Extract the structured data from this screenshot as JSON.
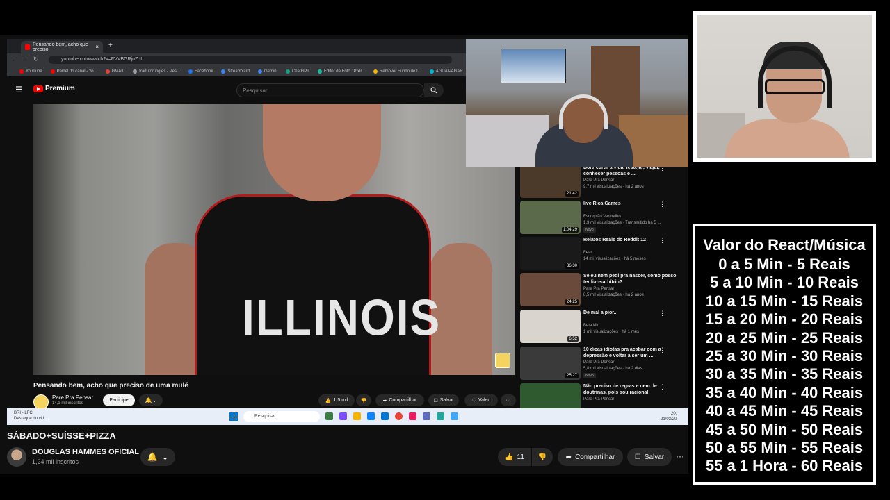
{
  "browser": {
    "tab_title": "Pensando bem, acho que preciso",
    "tab_close": "×",
    "new_tab": "+",
    "url": "youtube.com/watch?v=FVVBGRjuZ.II",
    "bookmarks": [
      "YouTube",
      "Painel do canal - Yo...",
      "GMAIL",
      "tradutor ingles - Pes...",
      "Facebook",
      "StreamYard",
      "Gemini",
      "ChatGPT",
      "Editor de Foto : Pixlr...",
      "Remover Fundo de I...",
      "AGUA PAGAR"
    ]
  },
  "inner_youtube": {
    "logo": "Premium",
    "search_placeholder": "Pesquisar",
    "video_title": "Pensando bem, acho que preciso de uma mulé",
    "jersey_text": "ILLINOIS",
    "channel_name": "Pare Pra Pensar",
    "channel_subs": "14,1 mil inscritos",
    "join_label": "Participe",
    "like_count": "1,5 mil",
    "share_label": "Compartilhar",
    "save_label": "Salvar",
    "thanks_label": "Valeu",
    "more": "···"
  },
  "suggestions": [
    {
      "title": "Bora curtir a vida, festejar, viajar, conhecer pessoas e ...",
      "channel": "Pare Pra Pensar",
      "views": "9,7 mil visualizações · há 2 anos",
      "duration": "21:42",
      "thumb_color": "#4b3a2a"
    },
    {
      "title": "live Rica Games",
      "channel": "Escorpião Vermelho",
      "views": "1,3 mil visualizações · Transmitido há 5 ...",
      "badge": "Novo",
      "duration": "1:04:29",
      "thumb_color": "#5a6a4a"
    },
    {
      "title": "Relatos Reais do Reddit 12",
      "channel": "Fear",
      "views": "14 mil visualizações · há 5 meses",
      "duration": "36:30",
      "thumb_color": "#1a1a1a"
    },
    {
      "title": "Se eu nem pedi pra nascer, como posso ter livre-arbítrio?",
      "channel": "Pare Pra Pensar",
      "views": "8,5 mil visualizações · há 2 anos",
      "duration": "24:25",
      "thumb_color": "#6a4a3a"
    },
    {
      "title": "De mal a pior..",
      "channel": "Beta Nio",
      "views": "1 mil visualizações · há 1 mês",
      "duration": "6:52",
      "thumb_color": "#d9d4ce"
    },
    {
      "title": "10 dicas idiotas pra acabar com a depressão e voltar a ser um ...",
      "channel": "Pare Pra Pensar",
      "views": "5,8 mil visualizações · há 2 dias",
      "badge": "Novo",
      "duration": "25:27",
      "thumb_color": "#3a3a3a"
    },
    {
      "title": "Não preciso de regras e nem de doutrinas, pois sou racional",
      "channel": "Pare Pra Pensar",
      "views": "",
      "duration": "",
      "thumb_color": "#2f5a2f"
    }
  ],
  "taskbar": {
    "left_line1": "BRI - LFC",
    "left_line2": "Destaque do vid...",
    "search": "Pesquisar",
    "time": "20:",
    "date": "21/03/20"
  },
  "prices": {
    "title": "Valor do React/Música",
    "rows": [
      "0 a 5 Min - 5 Reais",
      "5 a 10 Min - 10 Reais",
      "10 a 15 Min - 15 Reais",
      "15 a 20 Min - 20 Reais",
      "20 a 25 Min - 25 Reais",
      "25 a 30 Min - 30 Reais",
      "30 a 35 Min - 35 Reais",
      "35 a 40 Min - 40 Reais",
      "40 a 45 Min - 45 Reais",
      "45 a 50 Min - 50 Reais",
      "50 a 55 Min - 55 Reais",
      "55 a 1 Hora - 60 Reais"
    ]
  },
  "main": {
    "title": "SÁBADO+SUÍSSE+PIZZA",
    "channel_name": "DOUGLAS HAMMES OFICIAL",
    "channel_subs": "1,24 mil inscritos",
    "like_count": "11",
    "share_label": "Compartilhar",
    "save_label": "Salvar",
    "more": "···"
  }
}
